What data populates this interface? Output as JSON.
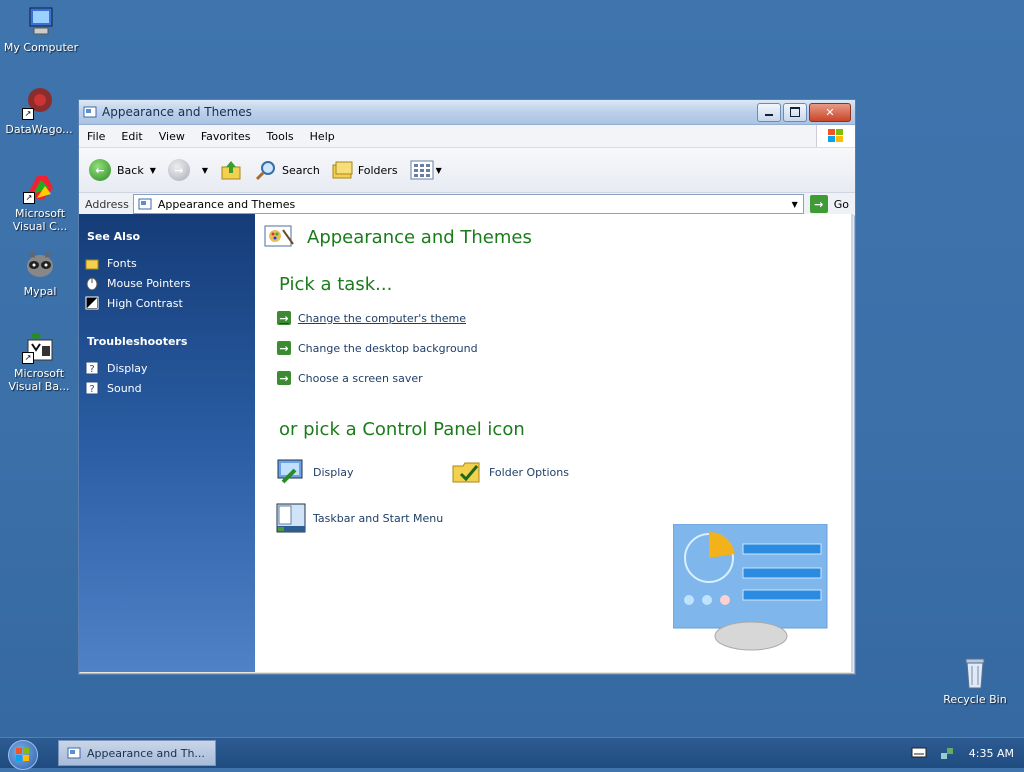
{
  "desktop": {
    "icons": [
      {
        "label": "My Computer"
      },
      {
        "label": "DataWago..."
      },
      {
        "label": "Microsoft Visual C..."
      },
      {
        "label": "Mypal"
      },
      {
        "label": "Microsoft Visual Ba..."
      },
      {
        "label": "Recycle Bin"
      }
    ]
  },
  "window": {
    "title": "Appearance and Themes",
    "menu": [
      "File",
      "Edit",
      "View",
      "Favorites",
      "Tools",
      "Help"
    ],
    "toolbar": {
      "back": "Back",
      "search": "Search",
      "folders": "Folders"
    },
    "address": {
      "label": "Address",
      "value": "Appearance and Themes",
      "go": "Go"
    }
  },
  "taskpane": {
    "see_also": {
      "header": "See Also",
      "items": [
        "Fonts",
        "Mouse Pointers",
        "High Contrast"
      ]
    },
    "troubleshooters": {
      "header": "Troubleshooters",
      "items": [
        "Display",
        "Sound"
      ]
    }
  },
  "main": {
    "title": "Appearance and Themes",
    "pick_task": "Pick a task...",
    "tasks": [
      "Change the computer's theme",
      "Change the desktop background",
      "Choose a screen saver"
    ],
    "pick_icon": "or pick a Control Panel icon",
    "icons": [
      "Display",
      "Folder Options",
      "Taskbar and Start Menu"
    ]
  },
  "taskbar": {
    "button": "Appearance and Th...",
    "clock": "4:35 AM"
  }
}
